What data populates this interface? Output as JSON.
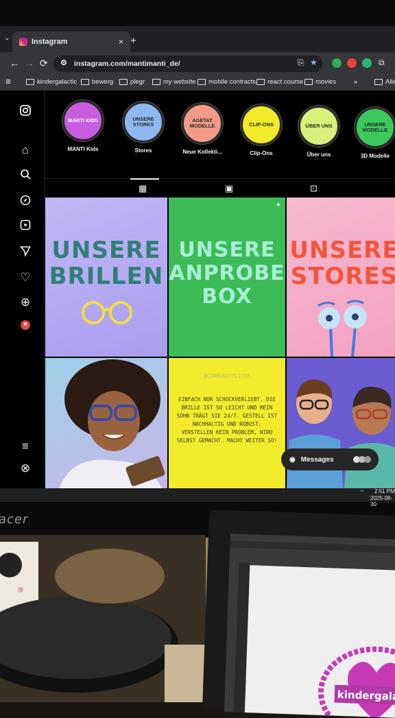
{
  "browser": {
    "tab_title": "Instagram",
    "tab_close": "×",
    "new_tab": "+",
    "tab_menu": "⌄",
    "url": "instagram.com/mantimanti_de/",
    "bookmarks": [
      "kindergalactic",
      "bewerg",
      "plegr",
      "my website",
      "mobile contracts",
      "react course",
      "movies"
    ],
    "bookmarks_more": "»",
    "bookmarks_all": "Alle",
    "nav": {
      "back": "←",
      "forward": "→",
      "reload": "⟳"
    }
  },
  "instagram": {
    "highlights": [
      {
        "circle_text": "MANTI KIDS",
        "label": "MANTI Kids",
        "color": "#c95de0"
      },
      {
        "circle_text": "UNSERE STORES",
        "label": "Stores",
        "color": "#8fb8f0"
      },
      {
        "circle_text": "AGETAT MODELLE",
        "label": "Neue Kollekti...",
        "color": "#f39a88"
      },
      {
        "circle_text": "CLIP-ONS",
        "label": "Clip-Ons",
        "color": "#f3ea2a"
      },
      {
        "circle_text": "ÜBER UNS",
        "label": "Über uns",
        "color": "#d9f07a"
      },
      {
        "circle_text": "UNSERE MODELLE",
        "label": "3D Modelle",
        "color": "#3cc85a"
      }
    ],
    "posts": {
      "brillen": "UNSERE BRILLEN",
      "anprobe": "UNSERE ANPROBE BOX",
      "stores": "UNSERE STORES",
      "community_tag": "#COMMUNITYLIEBE",
      "quote": "EINFACH NUR SCHOCKVERLIEBT. DIE BRILLE IST SO LEICHT UND MEIN SOHN TRÄGT SIE 24/7. GESTELL IST NACHHALTIG UND ROBUST. VERSTELLEN KEIN PROBLEM, WIRD SELBST GEMACHT. MACHT WEITER SO!"
    },
    "messages_label": "Messages"
  },
  "taskbar": {
    "time": "2:51 PM",
    "date": "2025-08-30"
  },
  "monitor_brand": "acer",
  "laptop": {
    "logo_text": "kindergalactic"
  }
}
